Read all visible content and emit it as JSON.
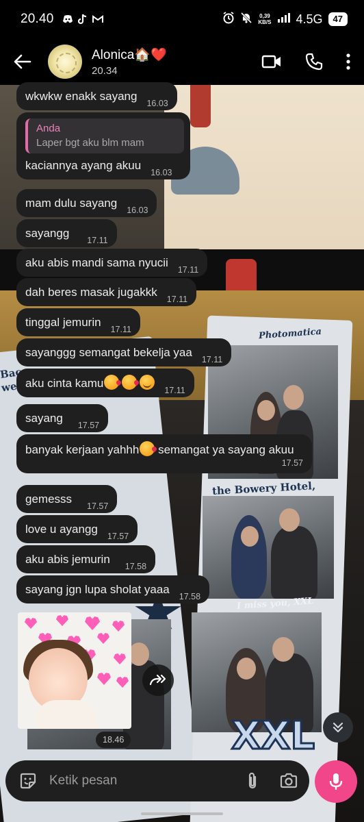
{
  "status_bar": {
    "time": "20.40",
    "net_speed_value": "0,39",
    "net_speed_unit": "KB/S",
    "network": "4.5G",
    "battery": "47"
  },
  "header": {
    "contact_name": "Alonica🏠❤️",
    "last_seen": "20.34"
  },
  "messages": [
    {
      "text": "wkwkw enakk sayang",
      "time": "16.03"
    },
    {
      "reply": {
        "name": "Anda",
        "text": "Laper bgt aku blm mam"
      },
      "text": "kaciannya ayang akuu",
      "time": "16.03"
    },
    {
      "text": "mam dulu sayang",
      "time": "16.03"
    },
    {
      "text": "sayangg",
      "time": "17.11"
    },
    {
      "text": "aku abis mandi sama nyucii",
      "time": "17.11"
    },
    {
      "text": "dah beres masak jugakkk",
      "time": "17.11"
    },
    {
      "text": "tinggal jemurin",
      "time": "17.11"
    },
    {
      "text": "sayanggg semangat bekelja yaa",
      "time": "17.11"
    },
    {
      "text": "aku cinta kamu",
      "time": "17.11"
    },
    {
      "text": "sayang",
      "time": "17.57"
    },
    {
      "text_before": "banyak kerjaan yahhh",
      "text_after": " semangat ya sayang akuu",
      "time": "17.57"
    },
    {
      "text": "gemesss",
      "time": "17.57"
    },
    {
      "text": "love u ayangg",
      "time": "17.57"
    },
    {
      "text": "aku abis jemurin",
      "time": "17.58"
    },
    {
      "text": "sayang jgn lupa sholat yaaa",
      "time": "17.58"
    }
  ],
  "sticker": {
    "time": "18.46"
  },
  "wallpaper_text": {
    "brand": "Photomatica",
    "hotel": "the Bowery Hotel,",
    "miss": "I miss you, XXL",
    "xxl": "XXL",
    "left_frag1": "Bac",
    "left_frag2": "we"
  },
  "input": {
    "placeholder": "Ketik pesan"
  },
  "icons": {
    "back": "arrow-left-icon",
    "video": "video-call-icon",
    "call": "phone-icon",
    "menu": "more-vertical-icon",
    "emoji": "sticker-emoji-icon",
    "attach": "paperclip-icon",
    "camera": "camera-icon",
    "mic": "microphone-icon",
    "forward": "forward-icon",
    "scroll": "double-chevron-down-icon"
  },
  "colors": {
    "accent": "#f2468a",
    "reply_bar": "#e46aa9",
    "bubble": "#1f1f1f"
  }
}
